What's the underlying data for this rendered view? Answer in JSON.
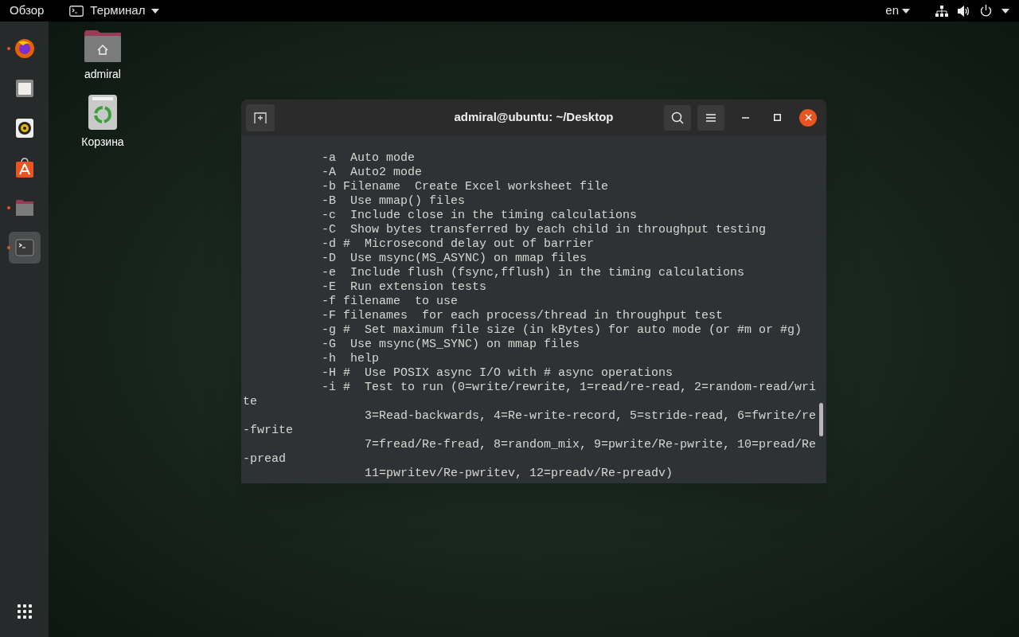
{
  "top_bar": {
    "activities": "Обзор",
    "app_menu": "Терминал",
    "keyboard_layout": "en"
  },
  "dock": {
    "items": [
      {
        "kind": "browser",
        "running": true,
        "selected": false
      },
      {
        "kind": "files",
        "running": false,
        "selected": false
      },
      {
        "kind": "music",
        "running": false,
        "selected": false
      },
      {
        "kind": "store",
        "running": false,
        "selected": false
      },
      {
        "kind": "folder",
        "running": true,
        "selected": false
      },
      {
        "kind": "terminal",
        "running": true,
        "selected": true
      }
    ]
  },
  "desktop_icons": [
    {
      "kind": "home",
      "label": "admiral"
    },
    {
      "kind": "trash",
      "label": "Корзина"
    }
  ],
  "terminal": {
    "title": "admiral@ubuntu: ~/Desktop",
    "lines": [
      "           -a  Auto mode",
      "           -A  Auto2 mode",
      "           -b Filename  Create Excel worksheet file",
      "           -B  Use mmap() files",
      "           -c  Include close in the timing calculations",
      "           -C  Show bytes transferred by each child in throughput testing",
      "           -d #  Microsecond delay out of barrier",
      "           -D  Use msync(MS_ASYNC) on mmap files",
      "           -e  Include flush (fsync,fflush) in the timing calculations",
      "           -E  Run extension tests",
      "           -f filename  to use",
      "           -F filenames  for each process/thread in throughput test",
      "           -g #  Set maximum file size (in kBytes) for auto mode (or #m or #g)",
      "           -G  Use msync(MS_SYNC) on mmap files",
      "           -h  help",
      "           -H #  Use POSIX async I/O with # async operations",
      "           -i #  Test to run (0=write/rewrite, 1=read/re-read, 2=random-read/wri",
      "te",
      "                 3=Read-backwards, 4=Re-write-record, 5=stride-read, 6=fwrite/re",
      "-fwrite",
      "                 7=fread/Re-fread, 8=random_mix, 9=pwrite/Re-pwrite, 10=pread/Re",
      "-pread",
      "                 11=pwritev/Re-pwritev, 12=preadv/Re-preadv)"
    ]
  }
}
